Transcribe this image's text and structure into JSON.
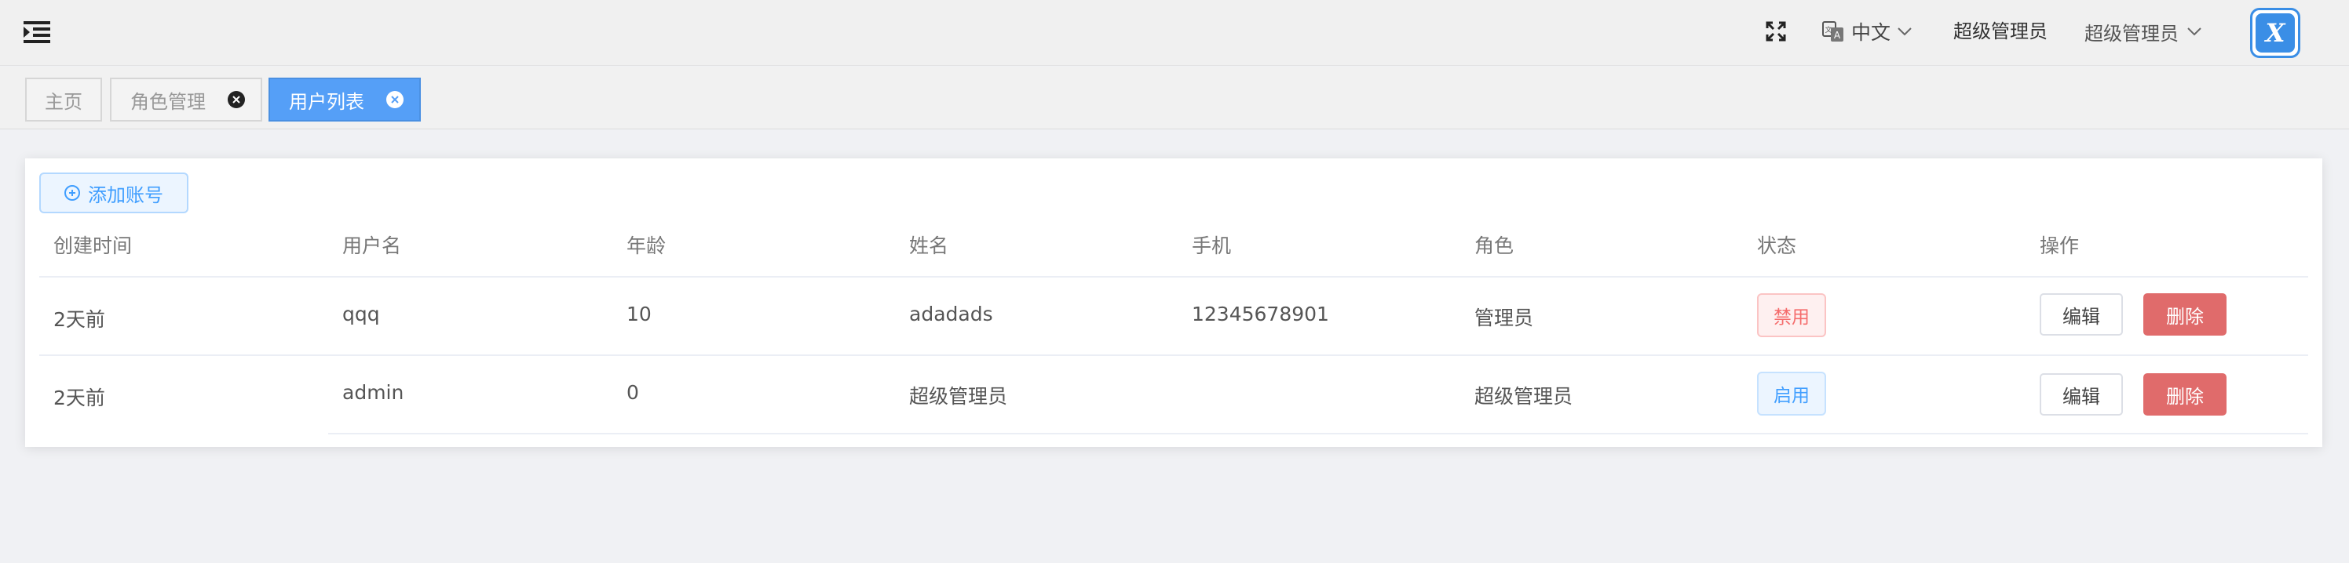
{
  "header": {
    "menu_icon": "menu-fold-icon",
    "fullscreen_icon": "fullscreen-icon",
    "language": {
      "icon": "translate-icon",
      "label": "中文",
      "caret": "chevron-down-icon"
    },
    "admin_name": "超级管理员",
    "user_menu": {
      "label": "超级管理员",
      "caret": "chevron-down-icon"
    },
    "avatar_letter": "X"
  },
  "tabs": [
    {
      "label": "主页",
      "closable": false,
      "active": false
    },
    {
      "label": "角色管理",
      "closable": true,
      "active": false
    },
    {
      "label": "用户列表",
      "closable": true,
      "active": true
    }
  ],
  "toolbar": {
    "add_label": "添加账号"
  },
  "table": {
    "columns": [
      "创建时间",
      "用户名",
      "年龄",
      "姓名",
      "手机",
      "角色",
      "状态",
      "操作"
    ],
    "rows": [
      {
        "created": "2天前",
        "username": "qqq",
        "age": "10",
        "name": "adadads",
        "phone": "12345678901",
        "role": "管理员",
        "status": "禁用",
        "status_type": "disabled",
        "edit": "编辑",
        "delete": "删除"
      },
      {
        "created": "2天前",
        "username": "admin",
        "age": "0",
        "name": "超级管理员",
        "phone": "",
        "role": "超级管理员",
        "status": "启用",
        "status_type": "enabled",
        "edit": "编辑",
        "delete": "删除"
      }
    ]
  },
  "colors": {
    "primary": "#409eff",
    "active_tab": "#559ff7",
    "danger": "#e06b6b",
    "page_bg": "#f0f1f4"
  }
}
